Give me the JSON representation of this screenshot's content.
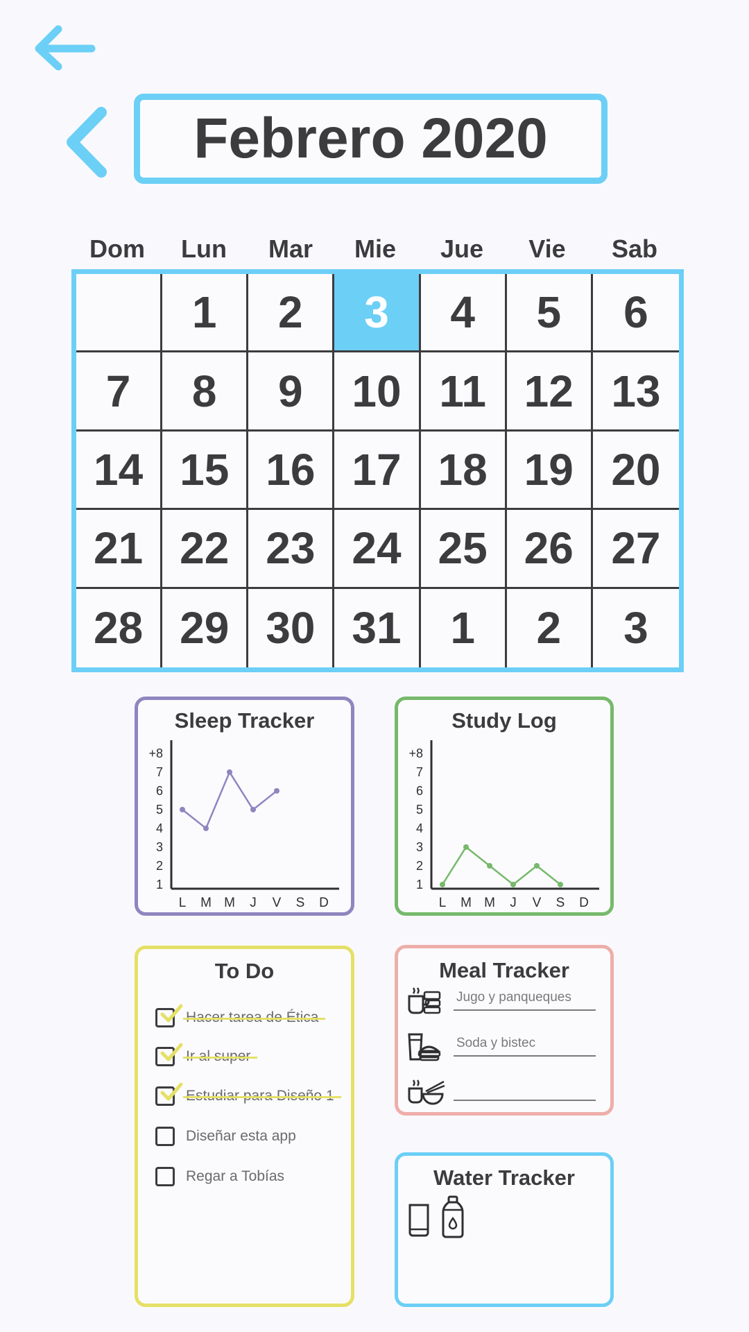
{
  "header": {
    "title": "Febrero 2020"
  },
  "calendar": {
    "weekdays": [
      "Dom",
      "Lun",
      "Mar",
      "Mie",
      "Jue",
      "Vie",
      "Sab"
    ],
    "weeks": [
      [
        "",
        "1",
        "2",
        "3",
        "4",
        "5",
        "6"
      ],
      [
        "7",
        "8",
        "9",
        "10",
        "11",
        "12",
        "13"
      ],
      [
        "14",
        "15",
        "16",
        "17",
        "18",
        "19",
        "20"
      ],
      [
        "21",
        "22",
        "23",
        "24",
        "25",
        "26",
        "27"
      ],
      [
        "28",
        "29",
        "30",
        "31",
        "1",
        "2",
        "3"
      ]
    ],
    "selected_day": "3"
  },
  "sleep": {
    "title": "Sleep Tracker",
    "color": "#8f86c0"
  },
  "study": {
    "title": "Study Log",
    "color": "#77b96b"
  },
  "todo": {
    "title": "To Do",
    "items": [
      {
        "label": "Hacer tarea de Ética",
        "done": true
      },
      {
        "label": "Ir al super",
        "done": true
      },
      {
        "label": "Estudiar para Diseño 1",
        "done": true
      },
      {
        "label": "Diseñar esta app",
        "done": false
      },
      {
        "label": "Regar a Tobías",
        "done": false
      }
    ]
  },
  "meals": {
    "title": "Meal Tracker",
    "entries": [
      {
        "icon": "breakfast-icon",
        "value": "Jugo y panqueques"
      },
      {
        "icon": "lunch-icon",
        "value": "Soda y bistec"
      },
      {
        "icon": "dinner-icon",
        "value": ""
      }
    ]
  },
  "water": {
    "title": "Water Tracker",
    "icons": [
      "glass-icon",
      "bottle-icon"
    ]
  },
  "colors": {
    "accent": "#6ccff6",
    "text": "#3c3c3e",
    "sleep": "#8f86c0",
    "study": "#77b96b",
    "todo": "#e5e066",
    "meal": "#eeaeaa",
    "water": "#6ccff6"
  },
  "chart_data": [
    {
      "type": "line",
      "title": "Sleep Tracker",
      "categories": [
        "L",
        "M",
        "M",
        "J",
        "V",
        "S",
        "D"
      ],
      "y_ticks": [
        "1",
        "2",
        "3",
        "4",
        "5",
        "6",
        "7",
        "+8"
      ],
      "ylim": [
        1,
        8
      ],
      "series": [
        {
          "values": [
            5,
            4,
            7,
            5,
            6,
            null,
            null
          ]
        }
      ]
    },
    {
      "type": "line",
      "title": "Study Log",
      "categories": [
        "L",
        "M",
        "M",
        "J",
        "V",
        "S",
        "D"
      ],
      "y_ticks": [
        "1",
        "2",
        "3",
        "4",
        "5",
        "6",
        "7",
        "+8"
      ],
      "ylim": [
        1,
        8
      ],
      "series": [
        {
          "values": [
            1,
            3,
            2,
            1,
            2,
            1,
            null
          ]
        }
      ]
    }
  ]
}
